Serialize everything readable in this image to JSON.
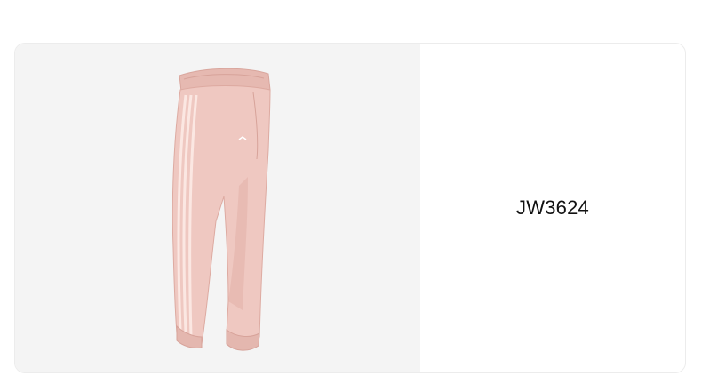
{
  "product": {
    "image_icon": "pink-track-pants-image",
    "sku": "JW3624",
    "colors": {
      "pant_base": "#efc8c1",
      "pant_shade": "#e2b2aa",
      "stripe": "#fbe7e2",
      "image_bg": "#f4f4f4"
    }
  }
}
